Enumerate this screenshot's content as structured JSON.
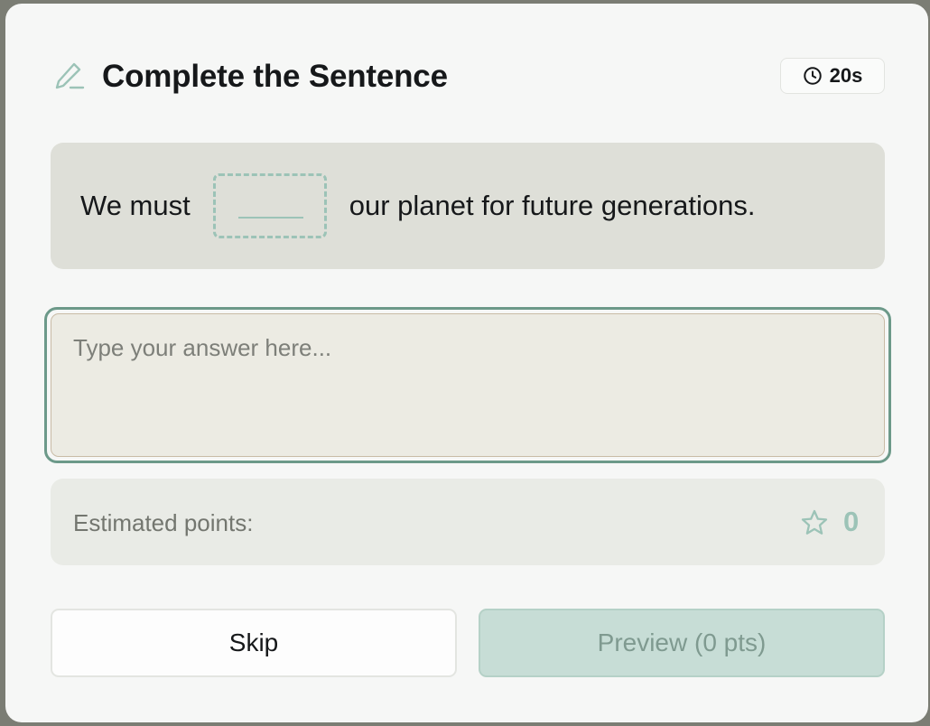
{
  "header": {
    "title": "Complete the Sentence",
    "timer": "20s",
    "icon": "pencil-icon",
    "timer_icon": "clock-icon"
  },
  "sentence": {
    "before": "We must",
    "blank": "_____",
    "after": "our planet for future generations."
  },
  "answer": {
    "placeholder": "Type your answer here...",
    "value": ""
  },
  "points": {
    "label": "Estimated points:",
    "value": "0",
    "icon": "star-icon"
  },
  "buttons": {
    "skip": "Skip",
    "preview": "Preview (0 pts)"
  },
  "colors": {
    "accent": "#6c9989",
    "accent_light": "#9cc3b7",
    "preview_bg": "#c7ddd6",
    "sentence_bg": "#dedfd8"
  }
}
